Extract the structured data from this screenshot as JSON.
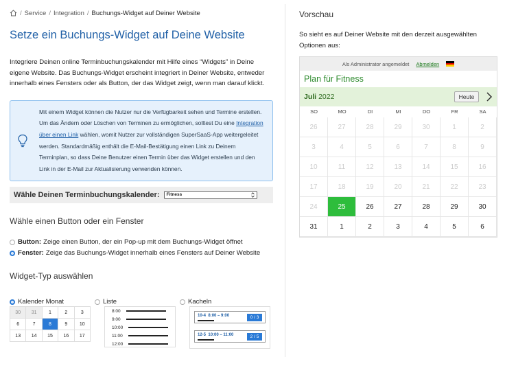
{
  "breadcrumb": {
    "items": [
      "Service",
      "Integration"
    ],
    "current": "Buchungs-Widget auf Deiner Website"
  },
  "page_title": "Setze ein Buchungs-Widget auf Deine Website",
  "intro": "Integriere Deinen online Terminbuchungskalender mit Hilfe eines “Widgets” in Deine eigene Website. Das Buchungs-Widget erscheint integriert in Deiner Website, entweder innerhalb eines Fensters oder als Button, der das Widget zeigt, wenn man darauf klickt.",
  "info": {
    "text_before": "Mit einem Widget können die Nutzer nur die Verfügbarkeit sehen und Termine erstellen. Um das Ändern oder Löschen von Terminen zu ermöglichen, solltest Du eine ",
    "link": "Integration über einen Link",
    "text_after": " wählen, womit Nutzer zur vollständigen SuperSaaS-App weitergeleitet werden. Standardmäßig enthält die E-Mail-Bestätigung einen Link zu Deinem Terminplan, so dass Deine Benutzer einen Termin über das Widget erstellen und den Link in der E-Mail zur Aktualisierung verwenden können."
  },
  "calendar_select": {
    "label": "Wähle Deinen Terminbuchungskalender:",
    "value": "Fitness"
  },
  "button_section": {
    "heading": "Wähle einen Button oder ein Fenster",
    "options": [
      {
        "bold": "Button:",
        "text": "Zeige einen Button, der ein Pop-up mit dem Buchungs-Widget öffnet",
        "selected": false
      },
      {
        "bold": "Fenster:",
        "text": "Zeige das Buchungs-Widget innerhalb eines Fensters auf Deiner Website",
        "selected": true
      }
    ]
  },
  "widget_type": {
    "heading": "Widget-Typ auswählen",
    "types": [
      {
        "label": "Kalender Monat",
        "selected": true
      },
      {
        "label": "Liste",
        "selected": false
      },
      {
        "label": "Kacheln",
        "selected": false
      }
    ],
    "month_rows": [
      [
        "30",
        "31",
        "1",
        "2",
        "3"
      ],
      [
        "6",
        "7",
        "8",
        "9",
        "10"
      ],
      [
        "13",
        "14",
        "15",
        "16",
        "17"
      ]
    ],
    "list_times": [
      "8:00",
      "9:00",
      "10:00",
      "11:00",
      "12:00"
    ],
    "tiles": [
      {
        "day": "10-4",
        "time": "8:00 – 9:00",
        "badge": "0 / 3"
      },
      {
        "day": "12-5",
        "time": "10:00 – 11:00",
        "badge": "2 / 5"
      }
    ]
  },
  "preview": {
    "title": "Vorschau",
    "subtitle": "So sieht es auf Deiner Website mit den derzeit ausgewählten Optionen aus:",
    "admin_text": "Als Administrator angemeldet",
    "logout": "Abmelden",
    "schedule_title": "Plan für Fitness",
    "month": "Juli",
    "year": "2022",
    "today_button": "Heute",
    "weekdays": [
      "SO",
      "MO",
      "DI",
      "MI",
      "DO",
      "FR",
      "SA"
    ],
    "weeks": [
      [
        "26",
        "27",
        "28",
        "29",
        "30",
        "1",
        "2"
      ],
      [
        "3",
        "4",
        "5",
        "6",
        "7",
        "8",
        "9"
      ],
      [
        "10",
        "11",
        "12",
        "13",
        "14",
        "15",
        "16"
      ],
      [
        "17",
        "18",
        "19",
        "20",
        "21",
        "22",
        "23"
      ],
      [
        "24",
        "25",
        "26",
        "27",
        "28",
        "29",
        "30"
      ],
      [
        "31",
        "1",
        "2",
        "3",
        "4",
        "5",
        "6"
      ]
    ],
    "today_cell": [
      4,
      1
    ],
    "past_until": [
      4,
      0
    ]
  },
  "colors": {
    "link_blue": "#1f5fa6",
    "today_green": "#2ebd3c",
    "title_green": "#2e8b2e"
  }
}
